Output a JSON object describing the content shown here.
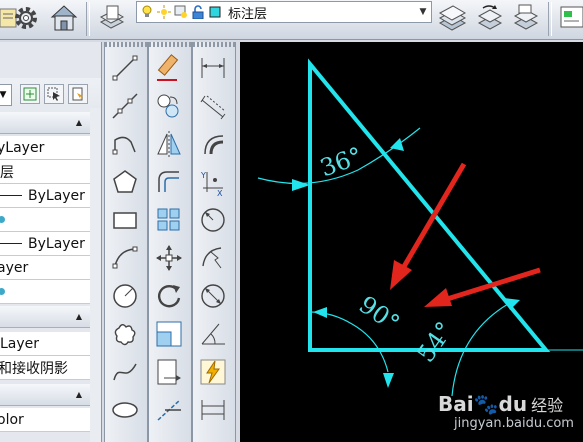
{
  "toolbar": {
    "layer_name": "标注层",
    "icons": [
      "layer-previous-icon",
      "settings-gear-icon",
      "home-icon",
      "layer-manager-icon",
      "lightbulb-icon",
      "sun-icon",
      "lock-icon",
      "color-swatch-icon",
      "layer-state-icon",
      "layer-match-icon",
      "layer-window-icon"
    ]
  },
  "properties_palette": {
    "rows": [
      {
        "text": "yLayer",
        "kind": "text"
      },
      {
        "text": "层",
        "kind": "text"
      },
      {
        "text": "ByLayer",
        "kind": "line"
      },
      {
        "text": "",
        "kind": "dot"
      },
      {
        "text": "ByLayer",
        "kind": "line"
      },
      {
        "text": "ayer",
        "kind": "text"
      },
      {
        "text": "",
        "kind": "dot"
      },
      {
        "text": "Layer",
        "kind": "text"
      },
      {
        "text": "和接收阴影",
        "kind": "text"
      },
      {
        "text": "olor",
        "kind": "text"
      }
    ]
  },
  "draw_toolbar": [
    "line-icon",
    "construction-line-icon",
    "polyline-icon",
    "polygon-icon",
    "rectangle-icon",
    "arc-icon",
    "circle-icon",
    "revcloud-icon",
    "spline-icon",
    "ellipse-icon"
  ],
  "modify_toolbar": [
    "erase-icon",
    "copy-icon",
    "mirror-icon",
    "offset-icon",
    "array-icon",
    "move-icon",
    "rotate-icon",
    "scale-icon",
    "stretch-icon",
    "trim-icon"
  ],
  "dimension_toolbar": [
    "linear-dim-icon",
    "aligned-dim-icon",
    "arc-length-icon",
    "ordinate-dim-icon",
    "radius-dim-icon",
    "jogged-dim-icon",
    "diameter-dim-icon",
    "angular-dim-icon",
    "quick-dim-icon",
    "baseline-dim-icon"
  ],
  "drawing": {
    "angle_top": "36°",
    "angle_right_angle": "90°",
    "angle_bottom_right": "54°",
    "line_color": "#22e4ec",
    "arrow_color": "#e2261d"
  },
  "watermark": {
    "logo": "Bai",
    "logo2": "du",
    "cn": "经验",
    "url": "jingyan.baidu.com"
  }
}
